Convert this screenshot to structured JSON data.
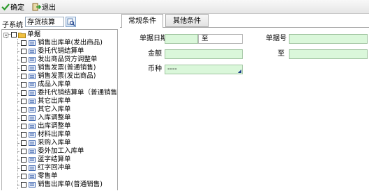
{
  "toolbar": {
    "confirm": "确定",
    "exit": "退出"
  },
  "subsystem": {
    "label": "子系统",
    "value": "存货核算"
  },
  "tree": {
    "root": "单据",
    "items": [
      "销售出库单(发出商品)",
      "委托代销结算单",
      "发出商品贷方调整单",
      "销售发票(普通销售)",
      "销售发票(发出商品)",
      "成品入库单",
      "委托代销结算单（普通销售）",
      "其它出库单",
      "其它入库单",
      "入库调整单",
      "出库调整单",
      "材料出库单",
      "采购入库单",
      "委外加工入库单",
      "蓝字结算单",
      "红字回冲单",
      "零售单",
      "销售出库单(普通销售)"
    ]
  },
  "tabs": {
    "general": "常规条件",
    "other": "其他条件"
  },
  "form": {
    "doc_date_label": "单据日期",
    "date_to": "至",
    "doc_no_label": "单据号",
    "amount_label": "金额",
    "amount_to_label": "至",
    "currency_label": "币种",
    "currency_value": "----"
  },
  "colors": {
    "field_bg": "#daf7da",
    "icon_blue": "#4a6fb5",
    "folder": "#f0c040"
  }
}
